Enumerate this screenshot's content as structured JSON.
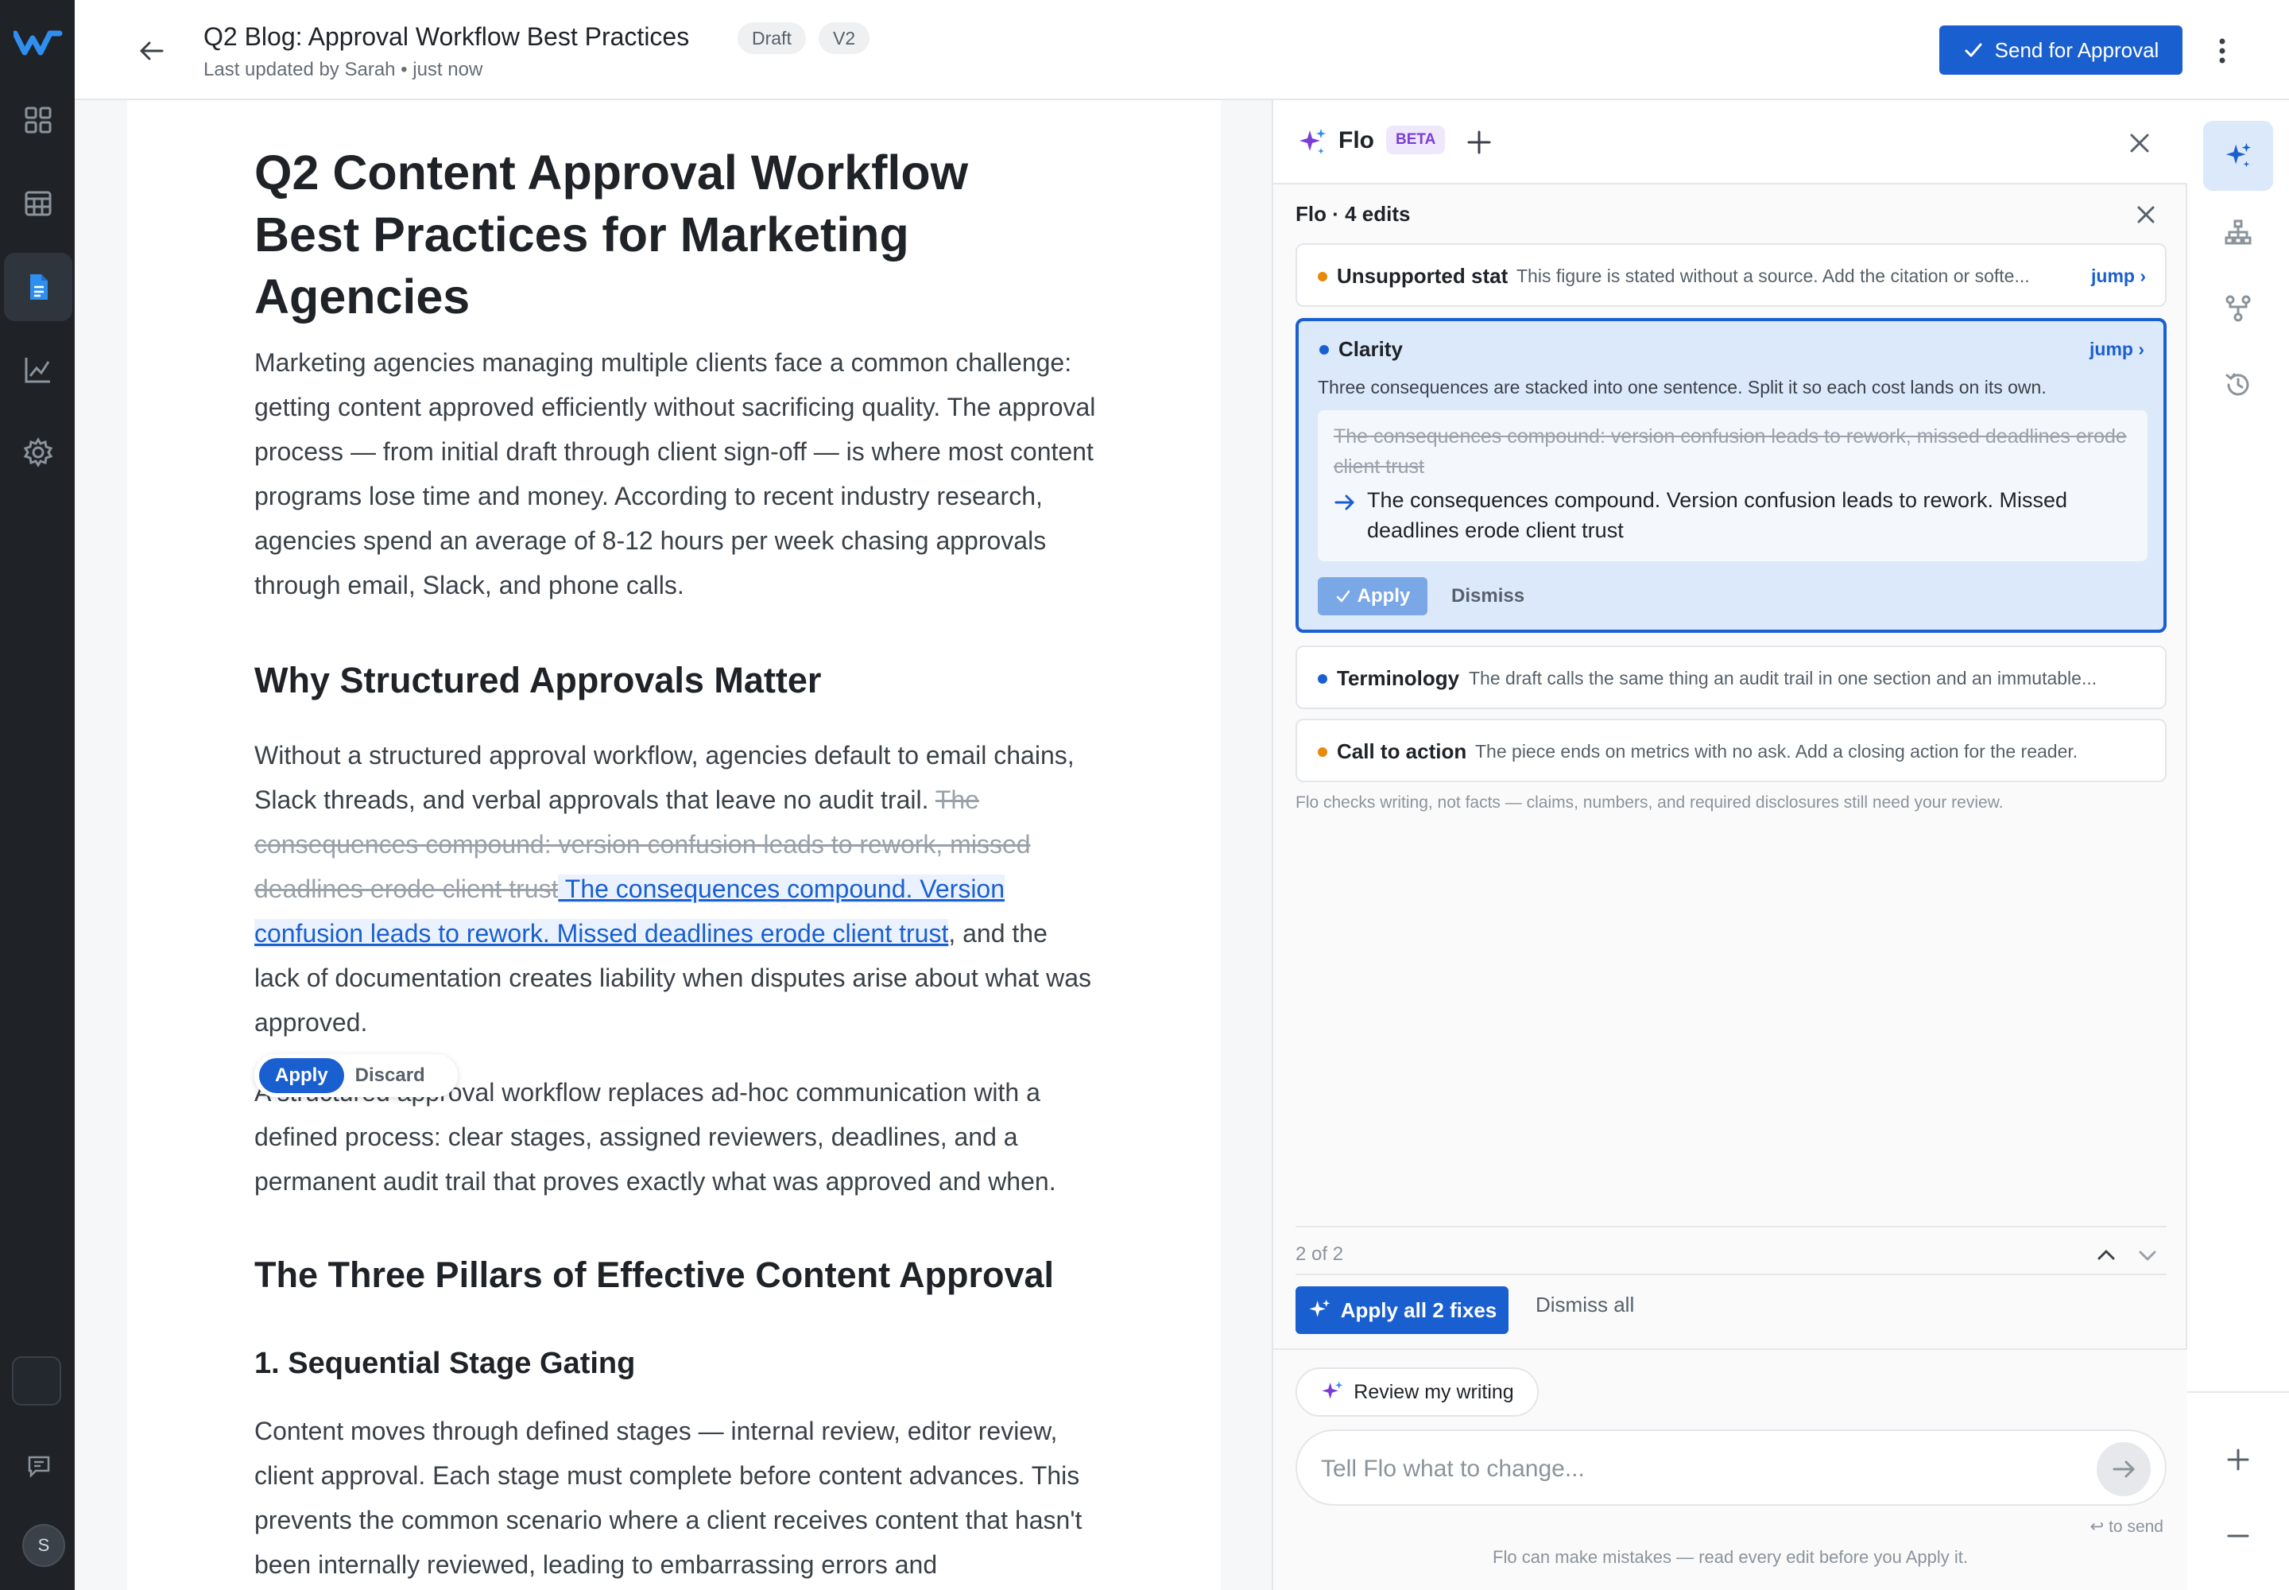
{
  "nav": {
    "items": [
      "dashboard-icon",
      "calendar-icon",
      "document-icon",
      "analytics-icon",
      "settings-icon"
    ],
    "active": "document-icon",
    "avatar_initial": "S"
  },
  "header": {
    "title": "Q2 Blog: Approval Workflow Best Practices",
    "badges": [
      "Draft",
      "V2"
    ],
    "subtitle": "Last updated by Sarah • just now",
    "send_label": "Send for Approval"
  },
  "document": {
    "title": "Q2 Content Approval Workflow Best Practices for Marketing Agencies",
    "intro": "Marketing agencies managing multiple clients face a common challenge: getting content approved efficiently without sacrificing quality. The approval process — from initial draft through client sign-off — is where most content programs lose time and money. According to recent industry research, agencies spend an average of 8-12 hours per week chasing approvals through email, Slack, and phone calls.",
    "h2_1": "Why Structured Approvals Matter",
    "p2_before": "Without a structured approval workflow, agencies default to email chains, Slack threads, and verbal approvals that leave no audit trail. ",
    "p2_deleted": "The consequences compound: version confusion leads to rework, missed deadlines erode client trust",
    "p2_inserted": " The consequences compound. Version confusion leads to rework. Missed deadlines erode client trust",
    "p2_after": ", and the lack of documentation creates liability when disputes arise about what was approved.",
    "p3": "A structured approval workflow replaces ad-hoc communication with a defined process: clear stages, assigned reviewers, deadlines, and a permanent audit trail that proves exactly what was approved and when.",
    "h2_2": "The Three Pillars of Effective Content Approval",
    "h3_1": "1. Sequential Stage Gating",
    "p4": "Content moves through defined stages — internal review, editor review, client approval. Each stage must complete before content advances. This prevents the common scenario where a client receives content that hasn't been internally reviewed, leading to embarrassing errors and",
    "inline_apply": "Apply",
    "inline_discard": "Discard"
  },
  "flo": {
    "name": "Flo",
    "beta": "BETA",
    "edits_title": "Flo · 4 edits",
    "cards": [
      {
        "type": "Unsupported stat",
        "desc": "This figure is stated without a source. Add the citation or softe...",
        "dot_color": "#e8890c",
        "jump": "jump ›"
      },
      {
        "type": "Clarity",
        "desc": "Three consequences are stacked into one sentence. Split it so each cost lands on its own.",
        "dot_color": "#1a5fd0",
        "jump": "jump ›",
        "old": "The consequences compound: version confusion leads to rework, missed deadlines erode client trust",
        "new": "The consequences compound. Version confusion leads to rework. Missed deadlines erode client trust",
        "apply": "Apply",
        "dismiss": "Dismiss"
      },
      {
        "type": "Terminology",
        "desc": "The draft calls the same thing an audit trail in one section and an immutable...",
        "dot_color": "#1a5fd0"
      },
      {
        "type": "Call to action",
        "desc": "The piece ends on metrics with no ask. Add a closing action for the reader.",
        "dot_color": "#e8890c"
      }
    ],
    "disclaimer": "Flo checks writing, not facts — claims, numbers, and required disclosures still need your review.",
    "pager": "2 of 2",
    "apply_all": "Apply all 2 fixes",
    "dismiss_all": "Dismiss all",
    "review_chip": "Review my writing",
    "composer_placeholder": "Tell Flo what to change...",
    "to_send": "↩ to send",
    "footnote": "Flo can make mistakes — read every edit before you Apply it."
  },
  "tools": [
    "flo-sparkle-icon",
    "hierarchy-icon",
    "branch-icon",
    "history-icon",
    "zoom-in-icon",
    "zoom-out-icon"
  ],
  "colors": {
    "accent": "#1a5fd0",
    "rail": "#1f2328",
    "beta": "#7a3ed6",
    "warning": "#e8890c"
  }
}
